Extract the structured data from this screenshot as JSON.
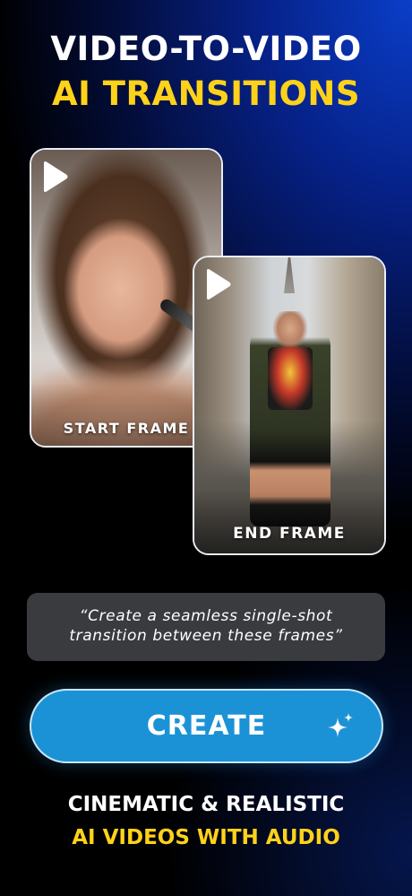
{
  "headline": {
    "line1": "VIDEO-TO-VIDEO",
    "line2": "AI TRANSITIONS"
  },
  "frames": {
    "start": {
      "label": "START FRAME",
      "icon": "play-icon"
    },
    "end": {
      "label": "END FRAME",
      "icon": "play-icon"
    }
  },
  "prompt": {
    "line1": "“Create a seamless single-shot",
    "line2": "transition between these frames”"
  },
  "create_button": {
    "label": "CREATE",
    "icon": "sparkle-icon"
  },
  "tagline": {
    "line1": "CINEMATIC & REALISTIC",
    "line2": "AI VIDEOS WITH AUDIO"
  },
  "colors": {
    "accent_yellow": "#ffd21a",
    "button_blue": "#1c92d6",
    "background_blue": "#0a3ec8",
    "prompt_bg": "#3a3b3f"
  }
}
